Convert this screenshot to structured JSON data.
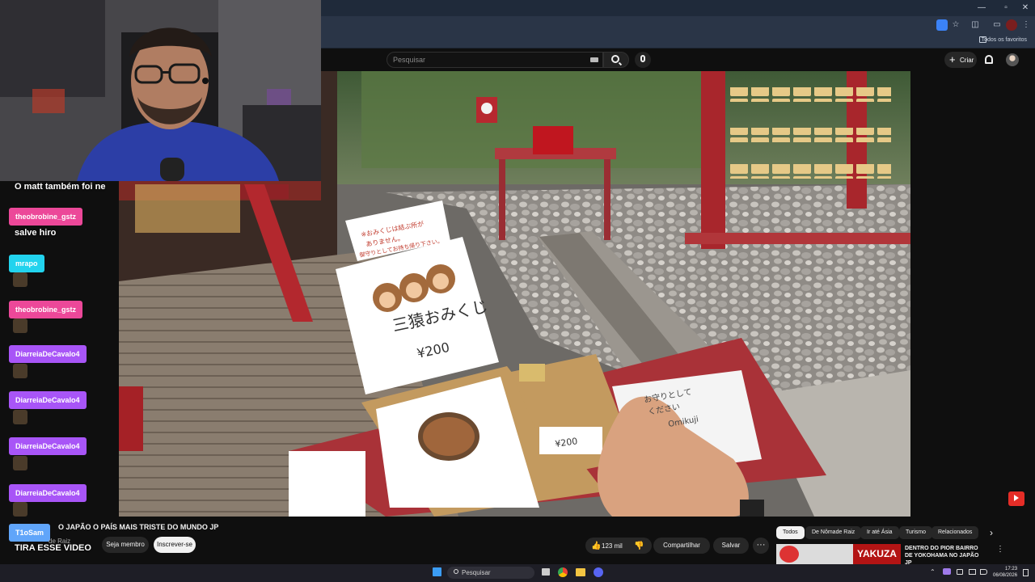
{
  "browser": {
    "bookmarks_label": "Todos os favoritos"
  },
  "youtube": {
    "search_placeholder": "Pesquisar",
    "create_label": "Criar"
  },
  "chat": {
    "messages": [
      {
        "type": "text",
        "text": "O matt também foi ne"
      },
      {
        "type": "name",
        "user": "theobrobine_gstz",
        "color": "#ec4899"
      },
      {
        "type": "text",
        "text": "salve hiro"
      },
      {
        "type": "name",
        "user": "mrapo",
        "color": "#22d3ee"
      },
      {
        "type": "emote"
      },
      {
        "type": "name",
        "user": "theobrobine_gstz",
        "color": "#ec4899"
      },
      {
        "type": "emote"
      },
      {
        "type": "name",
        "user": "DiarreiaDeCavalo4",
        "color": "#a855f7"
      },
      {
        "type": "emote"
      },
      {
        "type": "name",
        "user": "DiarreiaDeCavalo4",
        "color": "#a855f7"
      },
      {
        "type": "emote"
      },
      {
        "type": "name",
        "user": "DiarreiaDeCavalo4",
        "color": "#a855f7"
      },
      {
        "type": "emote"
      },
      {
        "type": "name",
        "user": "DiarreiaDeCavalo4",
        "color": "#a855f7"
      },
      {
        "type": "emote"
      },
      {
        "type": "name",
        "user": "T1oSam",
        "color": "#60a5fa"
      },
      {
        "type": "text",
        "text": "TIRA ESSE VIDEO"
      }
    ]
  },
  "video": {
    "title": "O JAPÃO O PAÍS MAIS TRISTE DO MUNDO JP",
    "channel": "de Raiz",
    "member_label": "Seja membro",
    "subscribe_label": "Inscrever-se",
    "likes": "123 mil",
    "share_label": "Compartilhar",
    "save_label": "Salvar",
    "more_label": "···",
    "sign_lines": [
      "三猿おみくじ",
      "¥200"
    ],
    "sign_top": [
      "※おみくじは結ぶ所が",
      "ありません。",
      "御守りとしてお持ち帰り下さい。"
    ],
    "price_label": "¥200",
    "card_text": [
      "お守りとして",
      "ください",
      "Omikuji"
    ]
  },
  "chips": [
    "Todos",
    "De Nômade Raiz",
    "Ir até Ásia",
    "Turismo",
    "Relacionados"
  ],
  "recommendation": {
    "thumb_text": "YAKUZA",
    "title": "DENTRO DO PIOR BAIRRO DE YOKOHAMA NO JAPÃO JP"
  },
  "taskbar": {
    "search_placeholder": "Pesquisar",
    "time": "17:23",
    "date": "06/08/2026"
  }
}
